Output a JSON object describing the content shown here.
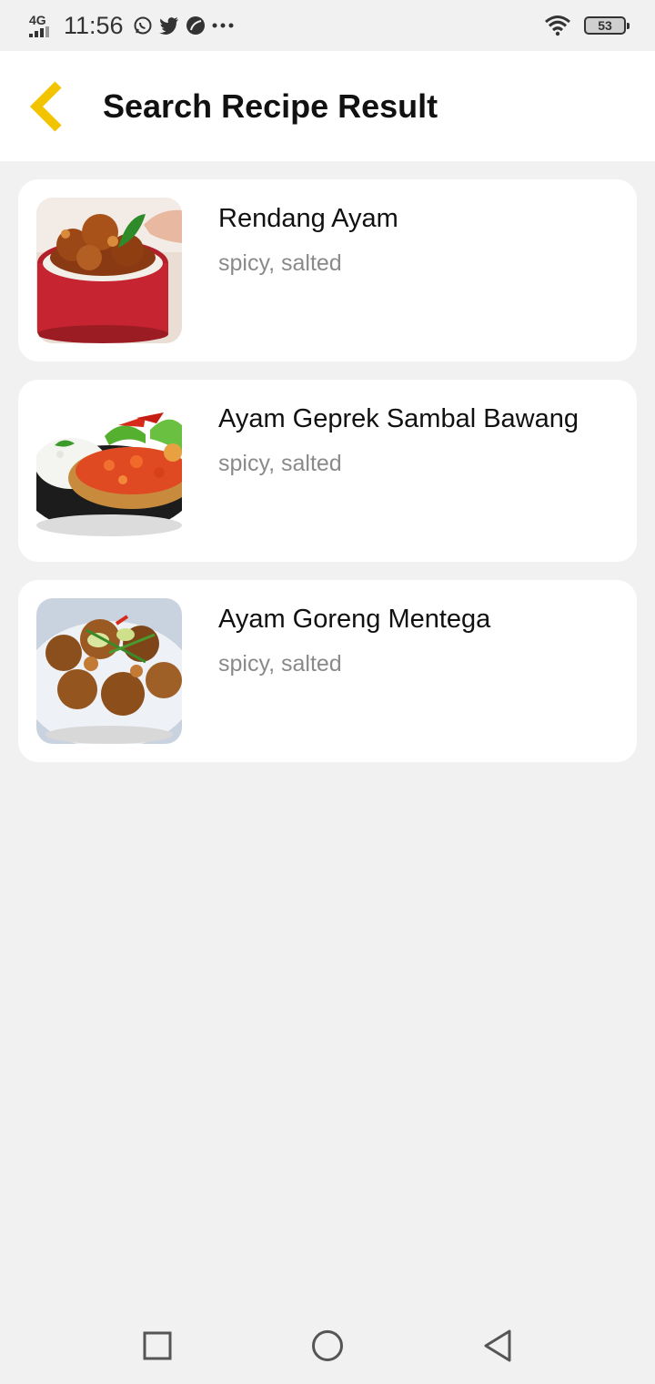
{
  "status_bar": {
    "network": "4G",
    "time": "11:56",
    "notification_icons": [
      "whatsapp-icon",
      "twitter-icon",
      "app-leaf-icon",
      "more-dots-icon"
    ],
    "battery_level": "53"
  },
  "header": {
    "title": "Search Recipe Result",
    "back_icon": "chevron-left-icon",
    "accent_color": "#F2C400"
  },
  "recipes": [
    {
      "name": "Rendang Ayam",
      "tags": "spicy, salted"
    },
    {
      "name": "Ayam Geprek Sambal Bawang",
      "tags": "spicy, salted"
    },
    {
      "name": "Ayam Goreng Mentega",
      "tags": "spicy, salted"
    }
  ],
  "nav_bar": {
    "buttons": [
      "recent-apps-icon",
      "home-icon",
      "back-icon"
    ]
  }
}
